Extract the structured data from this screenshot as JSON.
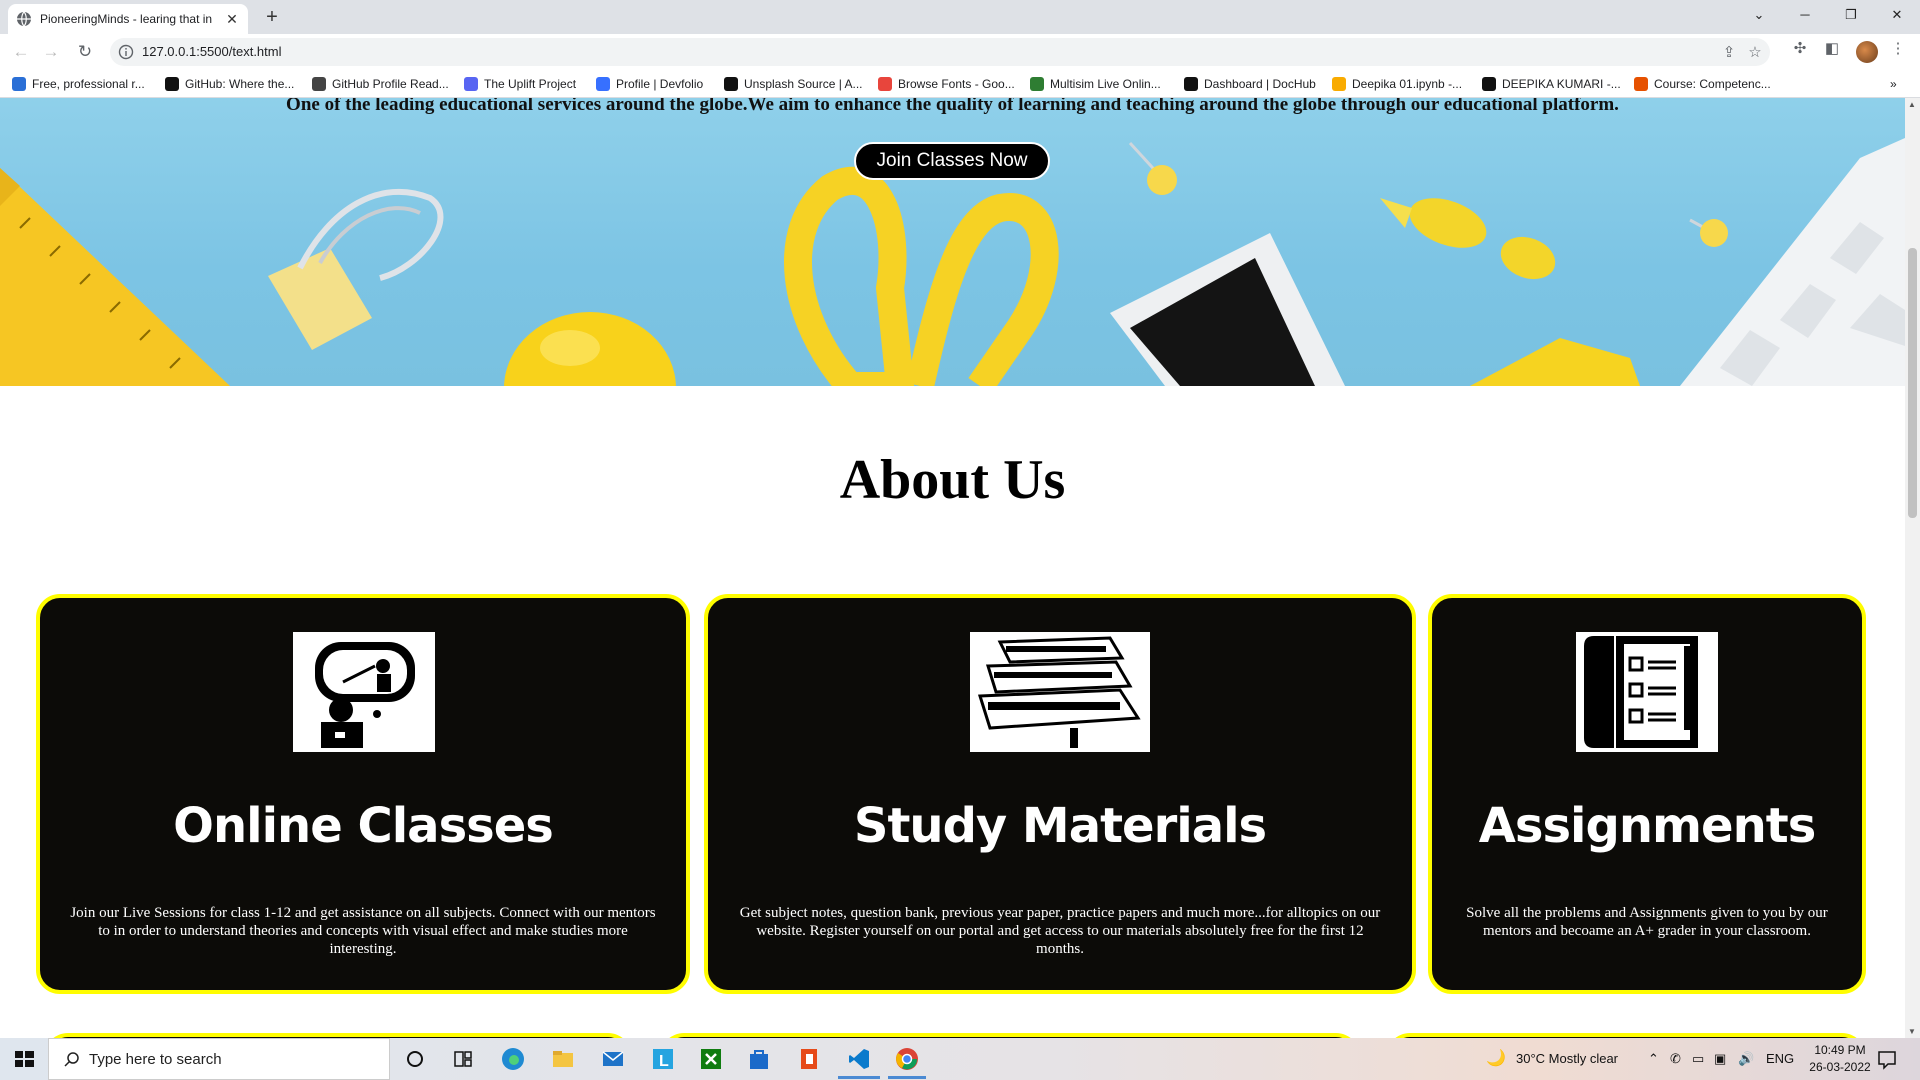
{
  "browser": {
    "tab_title": "PioneeringMinds - learing that in",
    "new_tab_label": "+",
    "url": "127.0.0.1:5500/text.html",
    "bookmarks": [
      {
        "label": "Free, professional r...",
        "color": "#2a6fd6"
      },
      {
        "label": "GitHub: Where the...",
        "color": "#111111"
      },
      {
        "label": "GitHub Profile Read...",
        "color": "#444444"
      },
      {
        "label": "The Uplift Project",
        "color": "#5865f2"
      },
      {
        "label": "Profile | Devfolio",
        "color": "#3770ff"
      },
      {
        "label": "Unsplash Source | A...",
        "color": "#111111"
      },
      {
        "label": "Browse Fonts - Goo...",
        "color": "#e8453c"
      },
      {
        "label": "Multisim Live Onlin...",
        "color": "#2e7d32"
      },
      {
        "label": "Dashboard | DocHub",
        "color": "#111111"
      },
      {
        "label": "Deepika 01.ipynb -...",
        "color": "#f9ab00"
      },
      {
        "label": "DEEPIKA KUMARI -...",
        "color": "#111111"
      },
      {
        "label": "Course: Competenc...",
        "color": "#e65100"
      }
    ],
    "more_bookmarks": "»"
  },
  "hero": {
    "tagline": "One of the leading educational services around the globe.We aim to enhance the quality of learning and teaching around the globe through our educational platform.",
    "cta_label": "Join Classes Now"
  },
  "about": {
    "title": "About Us",
    "accent_color": "#fffd00",
    "cards": [
      {
        "title": "Online Classes",
        "text": "Join our Live Sessions for class 1-12 and get assistance on all subjects. Connect with our mentors to in order to understand theories and concepts with visual effect and make studies more interesting.",
        "icon": "online-teacher-icon"
      },
      {
        "title": "Study Materials",
        "text": "Get subject notes, question bank, previous year paper, practice papers and much more...for alltopics on our website. Register yourself on our portal and get access to our materials absolutely free for the first 12 months.",
        "icon": "books-stack-icon"
      },
      {
        "title": "Assignments",
        "text": "Solve all the problems and Assignments given to you by our mentors and becoame an A+ grader in your classroom.",
        "icon": "checklist-icon"
      }
    ]
  },
  "taskbar": {
    "search_placeholder": "Type here to search",
    "weather": "30°C  Mostly clear",
    "language": "ENG",
    "time": "10:49 PM",
    "date": "26-03-2022"
  }
}
